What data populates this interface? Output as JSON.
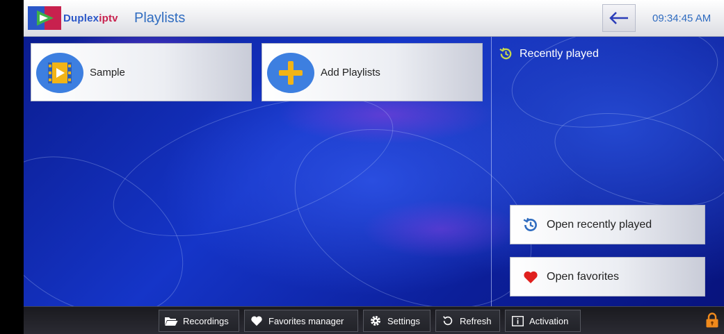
{
  "header": {
    "brand_part1": "Duplex",
    "brand_part2": "iptv",
    "title": "Playlists",
    "clock": "09:34:45 AM"
  },
  "playlists": [
    {
      "label": "Sample",
      "icon": "video-file-icon"
    },
    {
      "label": "Add Playlists",
      "icon": "plus-icon"
    }
  ],
  "recent": {
    "title": "Recently played",
    "open_recent_label": "Open recently played",
    "open_favorites_label": "Open favorites"
  },
  "footer": {
    "recordings_label": "Recordings",
    "favorites_manager_label": "Favorites manager",
    "settings_label": "Settings",
    "refresh_label": "Refresh",
    "activation_label": "Activation"
  },
  "colors": {
    "accent_blue": "#2f6cc0",
    "brand_red": "#c8214e",
    "icon_yellow": "#f2b417",
    "history_yellow": "#c8d94a",
    "heart_red": "#e0201e",
    "lock_orange": "#f08a1c"
  }
}
